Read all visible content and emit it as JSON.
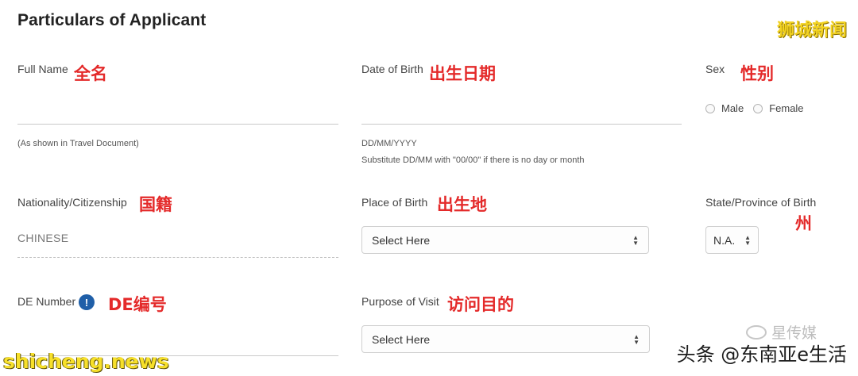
{
  "section_title": "Particulars of Applicant",
  "fields": {
    "full_name": {
      "label": "Full Name",
      "cn": "全名",
      "hint": "(As shown in Travel Document)"
    },
    "dob": {
      "label": "Date of Birth",
      "cn": "出生日期",
      "hint": "DD/MM/YYYY",
      "hint2": "Substitute DD/MM with \"00/00\" if there is no day or month"
    },
    "sex": {
      "label": "Sex",
      "cn": "性别",
      "options": [
        "Male",
        "Female"
      ]
    },
    "nationality": {
      "label": "Nationality/Citizenship",
      "cn": "国籍",
      "value": "CHINESE"
    },
    "place_of_birth": {
      "label": "Place of Birth",
      "cn": "出生地",
      "select_value": "Select Here"
    },
    "state": {
      "label": "State/Province of Birth",
      "cn": "州",
      "select_value": "N.A."
    },
    "de_number": {
      "label": "DE Number",
      "cn": "DE编号",
      "info": "!"
    },
    "purpose": {
      "label": "Purpose of Visit",
      "cn": "访问目的",
      "select_value": "Select Here"
    }
  },
  "watermarks": {
    "top_right": "狮城新闻",
    "bottom_left": "shicheng.news",
    "bottom_right": "头条 @东南亚e生活",
    "brand": "星传媒"
  },
  "colors": {
    "annotation": "#e42a2a",
    "info_icon": "#1f5fa8",
    "watermark_yellow": "#f3d321"
  }
}
